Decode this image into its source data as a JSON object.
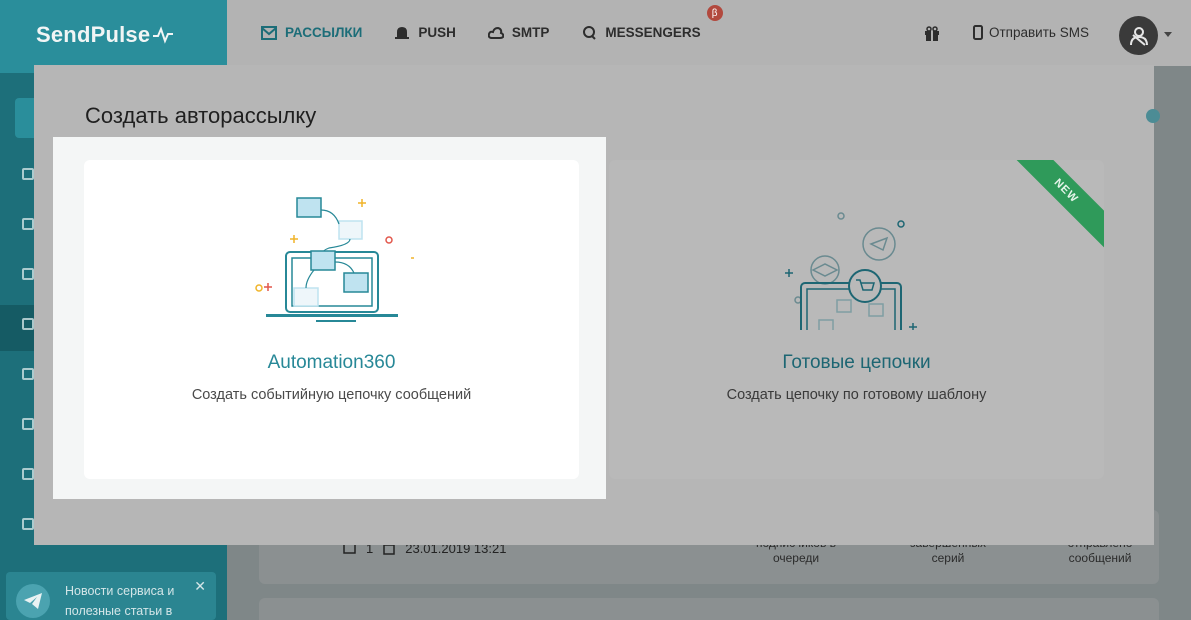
{
  "app": {
    "logo": "SendPulse"
  },
  "nav": {
    "items": [
      {
        "label": "РАССЫЛКИ",
        "icon": "mail-icon",
        "active": true
      },
      {
        "label": "PUSH",
        "icon": "bell-icon",
        "active": false
      },
      {
        "label": "SMTP",
        "icon": "cloud-icon",
        "active": false
      },
      {
        "label": "MESSENGERS",
        "icon": "chat-icon",
        "active": false
      }
    ],
    "beta_badge": "β",
    "sms_label": "Отправить SMS"
  },
  "sidebar": {
    "telegram_promo": "Новости сервиса и полезные статьи в",
    "close": "✕"
  },
  "background_list": {
    "count": "1",
    "date": "23.01.2019 13:21",
    "col1": "подписчиков в очереди",
    "col2": "завершенных серий",
    "col3": "отправлено сообщений"
  },
  "modal": {
    "title": "Создать авторассылку",
    "options": [
      {
        "title": "Automation360",
        "description": "Создать событийную цепочку сообщений"
      },
      {
        "title": "Готовые цепочки",
        "description": "Создать цепочку по готовому шаблону",
        "badge": "NEW"
      }
    ]
  },
  "colors": {
    "accent": "#278897",
    "sidebar": "#1d6f7a",
    "ribbon": "#2f9a5a"
  }
}
